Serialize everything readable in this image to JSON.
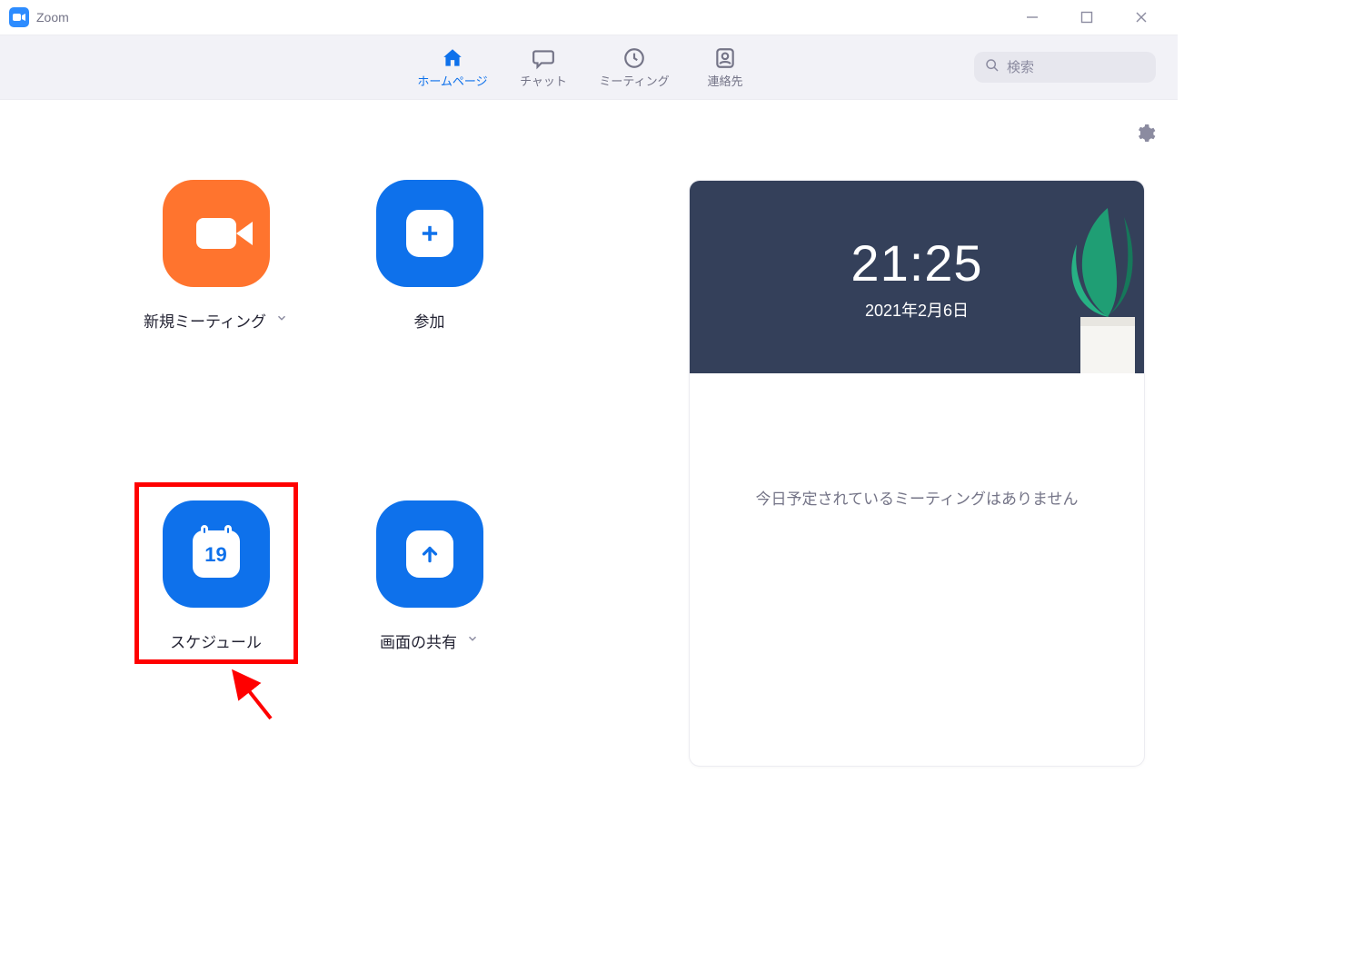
{
  "app": {
    "title": "Zoom"
  },
  "nav": {
    "tabs": [
      {
        "label": "ホームページ",
        "active": true,
        "icon": "home"
      },
      {
        "label": "チャット",
        "active": false,
        "icon": "chat"
      },
      {
        "label": "ミーティング",
        "active": false,
        "icon": "clock"
      },
      {
        "label": "連絡先",
        "active": false,
        "icon": "contacts"
      }
    ],
    "search_placeholder": "検索"
  },
  "actions": {
    "new_meeting": {
      "label": "新規ミーティング"
    },
    "join": {
      "label": "参加"
    },
    "schedule": {
      "label": "スケジュール",
      "calendar_day": "19"
    },
    "share_screen": {
      "label": "画面の共有"
    }
  },
  "panel": {
    "time": "21:25",
    "date": "2021年2月6日",
    "empty_message": "今日予定されているミーティングはありません"
  }
}
